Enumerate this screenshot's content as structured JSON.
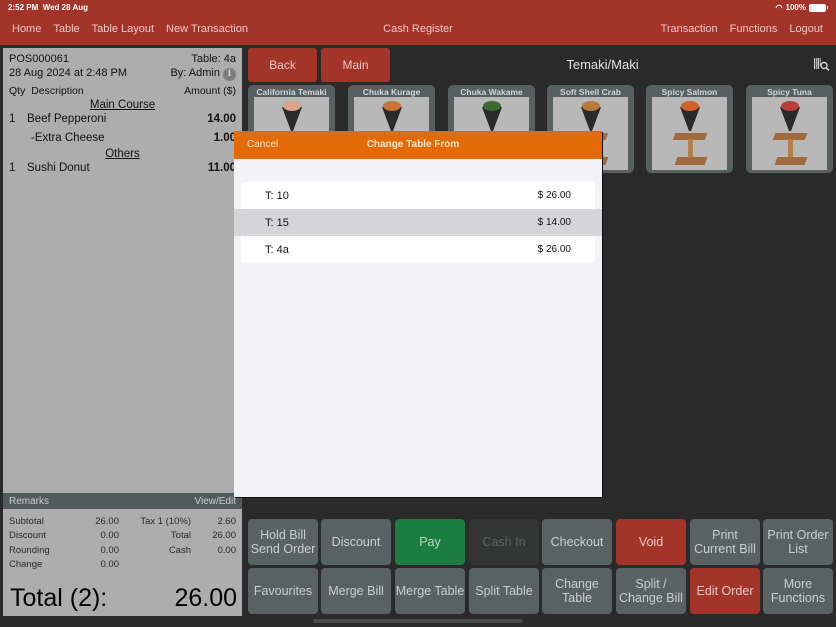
{
  "status_bar": {
    "time": "2:52 PM",
    "date": "Wed 28 Aug",
    "battery": "100%"
  },
  "nav": {
    "left": [
      "Home",
      "Table",
      "Table Layout",
      "New Transaction"
    ],
    "title": "Cash Register",
    "right": [
      "Transaction",
      "Functions",
      "Logout"
    ]
  },
  "receipt": {
    "order_no": "POS000061",
    "table": "Table: 4a",
    "datetime": "28 Aug 2024 at 2:48 PM",
    "by": "By: Admin",
    "info_icon": "i",
    "headers": {
      "qty": "Qty",
      "description": "Description",
      "amount": "Amount ($)"
    },
    "sections": [
      {
        "title": "Main Course",
        "items": [
          {
            "qty": "1",
            "name": "Beef Pepperoni",
            "amount": "14.00"
          },
          {
            "qty": "",
            "name": "-Extra Cheese",
            "amount": "1.00"
          }
        ]
      },
      {
        "title": "Others",
        "items": [
          {
            "qty": "1",
            "name": "Sushi Donut",
            "amount": "11.00"
          }
        ]
      }
    ],
    "remarks_label": "Remarks",
    "remarks_action": "View/Edit",
    "totals": [
      {
        "l1": "Subtotal",
        "v1": "26.00",
        "l2": "Tax 1 (10%)",
        "v2": "2.60"
      },
      {
        "l1": "Discount",
        "v1": "0.00",
        "l2": "Total",
        "v2": "26.00"
      },
      {
        "l1": "Rounding",
        "v1": "0.00",
        "l2": "Cash",
        "v2": "0.00"
      },
      {
        "l1": "Change",
        "v1": "0.00",
        "l2": "",
        "v2": ""
      }
    ],
    "grand_total_label": "Total (2):",
    "grand_total_value": "26.00"
  },
  "header": {
    "back": "Back",
    "main": "Main",
    "category": "Temaki/Maki",
    "barcode_icon": "barcode-search-icon"
  },
  "products": [
    {
      "name": "California Temaki",
      "topping": "#d9a58a"
    },
    {
      "name": "Chuka Kurage",
      "topping": "#c8743a"
    },
    {
      "name": "Chuka Wakame",
      "topping": "#3d6b2f"
    },
    {
      "name": "Soft Shell Crab",
      "topping": "#b8783a"
    },
    {
      "name": "Spicy Salmon",
      "topping": "#d1622a"
    },
    {
      "name": "Spicy Tuna",
      "topping": "#b8403a"
    }
  ],
  "modal": {
    "cancel": "Cancel",
    "title": "Change Table From",
    "tables": [
      {
        "table": "T: 10",
        "amount": "$ 26.00",
        "selected": false
      },
      {
        "table": "T: 15",
        "amount": "$ 14.00",
        "selected": true
      },
      {
        "table": "T: 4a",
        "amount": "$ 26.00",
        "selected": false
      }
    ]
  },
  "functions": {
    "row1": [
      {
        "label": "Hold Bill\nSend Order",
        "style": "normal"
      },
      {
        "label": "Discount",
        "style": "normal"
      },
      {
        "label": "Pay",
        "style": "green"
      },
      {
        "label": "Cash In",
        "style": "disabled"
      },
      {
        "label": "Checkout",
        "style": "normal"
      },
      {
        "label": "Void",
        "style": "red"
      },
      {
        "label": "Print\nCurrent Bill",
        "style": "normal"
      },
      {
        "label": "Print Order\nList",
        "style": "normal"
      }
    ],
    "row2": [
      {
        "label": "Favourites",
        "style": "normal"
      },
      {
        "label": "Merge Bill",
        "style": "normal"
      },
      {
        "label": "Merge Table",
        "style": "normal"
      },
      {
        "label": "Split Table",
        "style": "normal"
      },
      {
        "label": "Change\nTable",
        "style": "normal"
      },
      {
        "label": "Split /\nChange Bill",
        "style": "normal"
      },
      {
        "label": "Edit Order",
        "style": "red"
      },
      {
        "label": "More\nFunctions",
        "style": "normal"
      }
    ]
  }
}
